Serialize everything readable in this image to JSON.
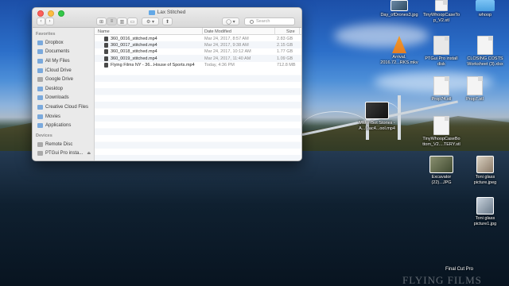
{
  "window": {
    "title": "Lax Stitched",
    "search_placeholder": "Search"
  },
  "toolbar": {
    "back": "‹",
    "forward": "›",
    "view_icons": "⊞",
    "view_list": "≡",
    "view_columns": "▥",
    "view_gallery": "▭",
    "arrange": "⚙ ▾",
    "share": "⬆",
    "tags": "◯ ▾"
  },
  "sidebar": {
    "favorites_header": "Favorites",
    "favorites": [
      {
        "label": "Dropbox",
        "icon": "dropbox-icon"
      },
      {
        "label": "Documents",
        "icon": "documents-icon"
      },
      {
        "label": "All My Files",
        "icon": "all-files-icon"
      },
      {
        "label": "iCloud Drive",
        "icon": "icloud-icon"
      },
      {
        "label": "Google Drive",
        "icon": "google-drive-icon"
      },
      {
        "label": "Desktop",
        "icon": "desktop-icon"
      },
      {
        "label": "Downloads",
        "icon": "downloads-icon"
      },
      {
        "label": "Creative Cloud Files",
        "icon": "creative-cloud-icon"
      },
      {
        "label": "Movies",
        "icon": "movies-icon"
      },
      {
        "label": "Applications",
        "icon": "applications-icon"
      }
    ],
    "devices_header": "Devices",
    "devices": [
      {
        "label": "Remote Disc",
        "icon": "remote-disc-icon"
      },
      {
        "label": "PTGui Pro insta...",
        "icon": "disk-icon"
      }
    ]
  },
  "columns": {
    "name": "Name",
    "date_modified": "Date Modified",
    "size": "Size"
  },
  "files": [
    {
      "name": "360_0016_stitched.mp4",
      "date": "Mar 24, 2017, 8:57 AM",
      "size": "2.83 GB"
    },
    {
      "name": "360_0017_stitched.mp4",
      "date": "Mar 24, 2017, 9:38 AM",
      "size": "2.15 GB"
    },
    {
      "name": "360_0018_stitched.mp4",
      "date": "Mar 24, 2017, 10:12 AM",
      "size": "1.77 GB"
    },
    {
      "name": "360_0019_stitched.mp4",
      "date": "Mar 24, 2017, 11:40 AM",
      "size": "1.09 GB"
    },
    {
      "name": "Flying Films NY - 36...House of Sports.mp4",
      "date": "Today, 4:36 PM",
      "size": "712.8 MB"
    }
  ],
  "desktop_icons": {
    "day_of_drones": "Day_ofDrones3.jpg",
    "tiny_whoop_case": "TinyWhoopCaseTo\np_V2.stl",
    "whoop": "whoop",
    "arrival": "Arrival.\n2016.72...RKS.mkv",
    "ptgui": "PTGui Pro install\ndisk",
    "closing_costs": "CLOSING COSTS\nWorksheet (3).xlsx",
    "prop74": "Prop74.stl",
    "prop7": "Prop7.stl",
    "makerbot": "MakerBot Stories -\nA...Mac4...ool.mp4",
    "tinywhoop_bottom": "TinyWhoopCaseBo\nttom_V2....TERY.stl",
    "excavator": "Excavator\n(22)...JPG",
    "toni_glass": "Toni glass\npicture.jpeg",
    "toni_glass1": "Toni glass\npicture1.jpg",
    "final_cut": "Final Cut Pro"
  },
  "watermark": "FLYING FILMS"
}
